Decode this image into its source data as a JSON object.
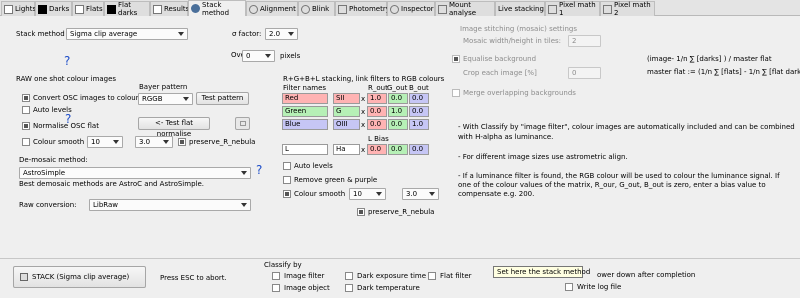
{
  "tabs": [
    {
      "label": "Lights",
      "color": "#ffffff"
    },
    {
      "label": "Darks",
      "color": "#000000"
    },
    {
      "label": "Flats",
      "color": "#ffffff"
    },
    {
      "label": "Flat darks",
      "color": "#000000"
    },
    {
      "label": "Results",
      "color": "#ffffff"
    },
    {
      "label": "Stack method",
      "color": "#4a6f9a"
    },
    {
      "label": "Alignment",
      "color": "#888888"
    },
    {
      "label": "Blink",
      "color": "#888888"
    },
    {
      "label": "Photometry",
      "color": "#888888"
    },
    {
      "label": "Inspector",
      "color": "#888888"
    },
    {
      "label": "Mount analyse",
      "color": "#888888"
    },
    {
      "label": "Live stacking",
      "color": "#888888"
    },
    {
      "label": "Pixel math 1",
      "color": "#888888"
    },
    {
      "label": "Pixel math 2",
      "color": "#888888"
    }
  ],
  "stack": {
    "method_label": "Stack method",
    "method_value": "Sigma clip average",
    "sigma_label": "σ factor:",
    "sigma_value": "2.0",
    "oversize_label": "Oversize:",
    "oversize_value": "0",
    "oversize_unit": "pixels",
    "help": "?"
  },
  "raw": {
    "title": "RAW one shot colour images",
    "convert": "Convert OSC images to colour",
    "auto_levels": "Auto levels",
    "normalise": "Normalise OSC flat",
    "colour_smooth": "Colour smooth",
    "smooth_value": "10",
    "smooth_value2": "3.0",
    "preserve": "preserve_R_nebula",
    "bayer_label": "Bayer pattern",
    "bayer_value": "RGGB",
    "test_pattern": "Test pattern",
    "test_flat": "<- Test flat normalise",
    "help": "?",
    "demosaic_label": "De-mosaic method:",
    "demosaic_value": "AstroSimple",
    "demosaic_help": "?",
    "demosaic_note": "Best demosaic methods are AstroC and AstroSimple.",
    "raw_conv_label": "Raw conversion:",
    "raw_conv_value": "LibRaw"
  },
  "rgb": {
    "title": "R+G+B+L stacking, link filters to RGB colours",
    "filter_names": "Filter names",
    "r_out": "R_out",
    "g_out": "G_out",
    "b_out": "B_out",
    "rows": [
      {
        "name": "Red",
        "filter": "SII",
        "r": "1.0",
        "g": "0.0",
        "b": "0.0"
      },
      {
        "name": "Green",
        "filter": "G",
        "r": "0.0",
        "g": "1.0",
        "b": "0.0"
      },
      {
        "name": "Blue",
        "filter": "OIII",
        "r": "0.0",
        "g": "0.0",
        "b": "1.0"
      }
    ],
    "l_bias": "L Bias",
    "l_name": "L",
    "l_filter": "Ha",
    "l_r": "0.0",
    "l_g": "0.0",
    "l_b": "0.0",
    "times": "x",
    "auto_levels": "Auto levels",
    "remove_green": "Remove green & purple",
    "colour_smooth": "Colour smooth",
    "smooth_value": "10",
    "smooth_value2": "3.0",
    "preserve": "preserve_R_nebula"
  },
  "mosaic": {
    "title": "Image stitching (mosaic) settings",
    "width_label": "Mosaic width/height in tiles:",
    "width_value": "2",
    "equalise": "Equalise background",
    "crop_label": "Crop each image [%]",
    "crop_value": "0",
    "merge": "Merge overlapping backgrounds"
  },
  "formulas": {
    "line1": "(image- 1/n ∑ [darks] ) / master flat",
    "line2": "master flat := (1/n ∑ [flats] - 1/n ∑ [flat darks] )"
  },
  "notes": {
    "n1": "- With Classify by \"image filter\", colour images are automatically included and can be combined",
    "n1b": "with H-alpha as luminance.",
    "n2": "- For different image sizes use astrometric align.",
    "n3": "- If a luminance filter is found, the RGB colour will be used to colour the luminance signal. If",
    "n3b": "one of the colour values of the matrix, R_our, G_out, B_out is zero, enter a bias value to",
    "n3c": "compensate e.g. 200."
  },
  "bottom": {
    "stack_button": "STACK  (Sigma clip average)",
    "abort": "Press ESC to abort.",
    "classify": "Classify by",
    "image_filter": "Image filter",
    "image_object": "Image object",
    "dark_exposure": "Dark exposure time",
    "dark_temperature": "Dark temperature",
    "flat_filter": "Flat filter",
    "tooltip": "Set here the stack method",
    "power_down": "ower down after completion",
    "write_log": "Write log file"
  }
}
